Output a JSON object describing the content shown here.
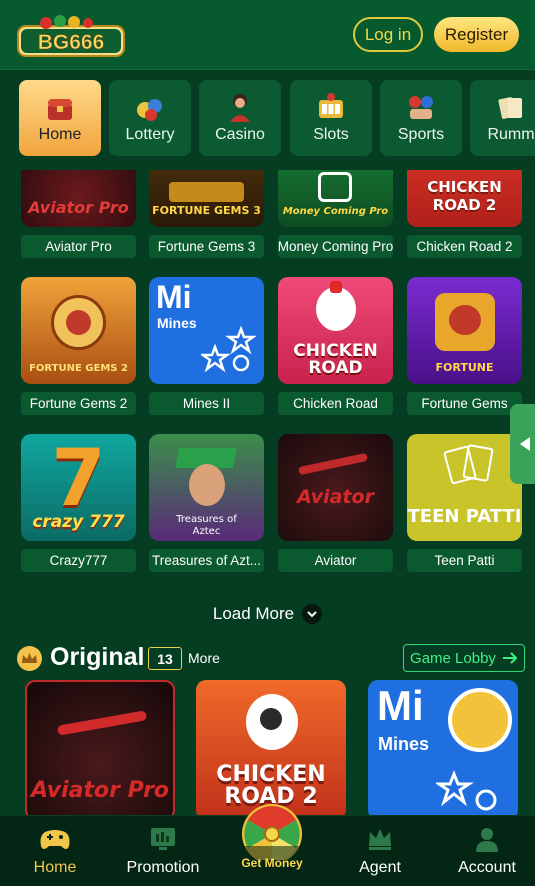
{
  "header": {
    "logo_text": "BG666",
    "login_label": "Log in",
    "register_label": "Register"
  },
  "categories": [
    {
      "label": "Home",
      "icon": "home-chest-icon",
      "active": true
    },
    {
      "label": "Lottery",
      "icon": "lottery-balls-icon",
      "active": false
    },
    {
      "label": "Casino",
      "icon": "casino-dealer-icon",
      "active": false
    },
    {
      "label": "Slots",
      "icon": "slots-icon",
      "active": false
    },
    {
      "label": "Sports",
      "icon": "sports-icon",
      "active": false
    },
    {
      "label": "Rumm",
      "icon": "rummy-cards-icon",
      "active": false
    }
  ],
  "games": [
    {
      "name": "Aviator Pro",
      "art": "Aviator Pro"
    },
    {
      "name": "Fortune Gems 3",
      "art": "FORTUNE GEMS 3"
    },
    {
      "name": "Money Coming Pro",
      "art": "Money Coming Pro"
    },
    {
      "name": "Chicken Road 2",
      "art": "CHICKEN ROAD 2"
    },
    {
      "name": "Fortune Gems 2",
      "art": "FORTUNE GEMS 2"
    },
    {
      "name": "Mines II",
      "art": "Mi",
      "art_sub": "Mines"
    },
    {
      "name": "Chicken Road",
      "art": "CHICKEN ROAD"
    },
    {
      "name": "Fortune Gems",
      "art": "FORTUNE"
    },
    {
      "name": "Crazy777",
      "art": "crazy 777"
    },
    {
      "name": "Treasures of Azt...",
      "art": "Treasures of Aztec"
    },
    {
      "name": "Aviator",
      "art": "Aviator"
    },
    {
      "name": "Teen Patti",
      "art": "TEEN PATTI"
    }
  ],
  "load_more_label": "Load More",
  "original": {
    "title": "Original",
    "count": "13",
    "more_label": "More",
    "lobby_label": "Game Lobby",
    "cards": [
      {
        "art": "Aviator Pro"
      },
      {
        "art": "CHICKEN ROAD 2"
      },
      {
        "art": "Mi",
        "art_sub": "Mines"
      }
    ]
  },
  "bottom_nav": [
    {
      "label": "Home",
      "icon": "gamepad-icon",
      "active": true
    },
    {
      "label": "Promotion",
      "icon": "promotion-icon",
      "active": false
    },
    {
      "label": "Get Money",
      "icon": "prize-wheel-icon",
      "active": false
    },
    {
      "label": "Agent",
      "icon": "crown-icon",
      "active": false
    },
    {
      "label": "Account",
      "icon": "user-icon",
      "active": false
    }
  ],
  "colors": {
    "background": "#053d22",
    "header": "#075a2e",
    "accent_gold": "#f2d94a",
    "lobby_green": "#3ff08a"
  }
}
